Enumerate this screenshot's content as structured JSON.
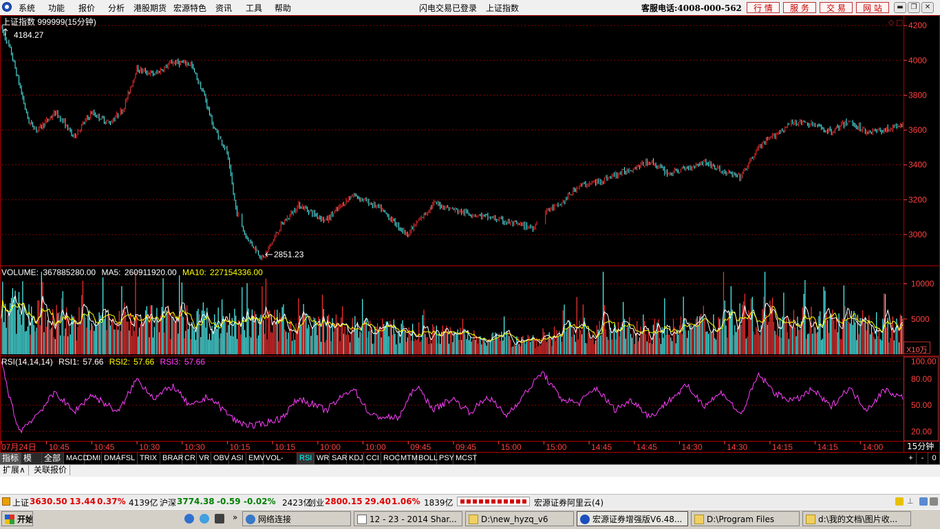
{
  "menu": {
    "items": [
      "系统",
      "功能",
      "报价",
      "分析",
      "港股期货",
      "宏源特色",
      "资讯",
      "工具",
      "帮助"
    ],
    "login_status": "闪电交易已登录",
    "current_index": "上证指数",
    "hotline": "客服电话:4008-000-562",
    "buttons": [
      "行 情",
      "服 务",
      "交 易",
      "网 站"
    ]
  },
  "chart": {
    "title": "上证指数 999999(15分钟)",
    "high_label": "4184.27",
    "low_label": "2851.23",
    "volume_header": {
      "name": "VOLUME:",
      "value": "367885280.00",
      "ma5_label": "MA5:",
      "ma5": "260911920.00",
      "ma10_label": "MA10:",
      "ma10": "227154336.00"
    },
    "volume_unit": "X10万",
    "rsi_header": {
      "name": "RSI(14,14,14)",
      "rsi1_label": "RSI1:",
      "rsi1": "57.66",
      "rsi2_label": "RSI2:",
      "rsi2": "57.66",
      "rsi3_label": "RSI3:",
      "rsi3": "57.66"
    },
    "period_label": "15分钟",
    "colors": {
      "up": "#ff3232",
      "down": "#54ffff",
      "ma5": "#ffffff",
      "ma10": "#ffff00",
      "rsi": "#ff40ff",
      "grid": "#8b0000",
      "axis": "#b00000"
    }
  },
  "chart_data": {
    "type": "candlestick",
    "price_axis": {
      "ticks": [
        3000,
        3200,
        3400,
        3600,
        3800,
        4000,
        4200
      ],
      "ylim": [
        2830,
        4240
      ]
    },
    "volume_axis": {
      "ticks": [
        5000,
        10000
      ],
      "ylim": [
        0,
        12000
      ]
    },
    "rsi_axis": {
      "ticks": [
        "20.00",
        "50.00",
        "80.00",
        "100.00"
      ],
      "ylim": [
        10,
        105
      ]
    },
    "x_ticks": [
      "07月24日",
      "10:45",
      "10:45",
      "10:30",
      "10:30",
      "10:15",
      "10:15",
      "10:00",
      "10:00",
      "09:45",
      "09:45",
      "15:00",
      "15:00",
      "14:45",
      "14:45",
      "14:30",
      "14:30",
      "14:15",
      "14:15",
      "14:00"
    ],
    "price_path": [
      [
        0,
        4184
      ],
      [
        0.01,
        4060
      ],
      [
        0.02,
        3860
      ],
      [
        0.03,
        3650
      ],
      [
        0.04,
        3600
      ],
      [
        0.06,
        3700
      ],
      [
        0.07,
        3640
      ],
      [
        0.08,
        3560
      ],
      [
        0.1,
        3700
      ],
      [
        0.12,
        3640
      ],
      [
        0.135,
        3720
      ],
      [
        0.15,
        3950
      ],
      [
        0.17,
        3920
      ],
      [
        0.19,
        3990
      ],
      [
        0.21,
        3980
      ],
      [
        0.225,
        3800
      ],
      [
        0.235,
        3620
      ],
      [
        0.25,
        3480
      ],
      [
        0.26,
        3150
      ],
      [
        0.27,
        3000
      ],
      [
        0.29,
        2860
      ],
      [
        0.31,
        3050
      ],
      [
        0.33,
        3170
      ],
      [
        0.36,
        3080
      ],
      [
        0.39,
        3230
      ],
      [
        0.42,
        3150
      ],
      [
        0.45,
        3000
      ],
      [
        0.48,
        3180
      ],
      [
        0.51,
        3130
      ],
      [
        0.54,
        3100
      ],
      [
        0.57,
        3060
      ],
      [
        0.59,
        3040
      ],
      [
        0.6,
        3130
      ],
      [
        0.62,
        3170
      ],
      [
        0.64,
        3280
      ],
      [
        0.66,
        3300
      ],
      [
        0.68,
        3340
      ],
      [
        0.7,
        3380
      ],
      [
        0.72,
        3420
      ],
      [
        0.74,
        3350
      ],
      [
        0.76,
        3380
      ],
      [
        0.78,
        3420
      ],
      [
        0.8,
        3360
      ],
      [
        0.82,
        3330
      ],
      [
        0.84,
        3500
      ],
      [
        0.86,
        3580
      ],
      [
        0.88,
        3650
      ],
      [
        0.9,
        3630
      ],
      [
        0.92,
        3590
      ],
      [
        0.94,
        3650
      ],
      [
        0.96,
        3590
      ],
      [
        0.98,
        3600
      ],
      [
        1,
        3630
      ]
    ],
    "rsi_path": [
      [
        0,
        100
      ],
      [
        0.01,
        55
      ],
      [
        0.02,
        20
      ],
      [
        0.04,
        40
      ],
      [
        0.06,
        65
      ],
      [
        0.08,
        42
      ],
      [
        0.1,
        62
      ],
      [
        0.13,
        42
      ],
      [
        0.15,
        80
      ],
      [
        0.17,
        58
      ],
      [
        0.19,
        72
      ],
      [
        0.21,
        48
      ],
      [
        0.23,
        60
      ],
      [
        0.26,
        32
      ],
      [
        0.28,
        26
      ],
      [
        0.31,
        35
      ],
      [
        0.33,
        58
      ],
      [
        0.36,
        44
      ],
      [
        0.39,
        70
      ],
      [
        0.41,
        38
      ],
      [
        0.44,
        35
      ],
      [
        0.46,
        72
      ],
      [
        0.48,
        45
      ],
      [
        0.5,
        58
      ],
      [
        0.52,
        42
      ],
      [
        0.54,
        60
      ],
      [
        0.56,
        38
      ],
      [
        0.58,
        62
      ],
      [
        0.6,
        88
      ],
      [
        0.62,
        58
      ],
      [
        0.64,
        52
      ],
      [
        0.66,
        70
      ],
      [
        0.68,
        45
      ],
      [
        0.7,
        56
      ],
      [
        0.72,
        36
      ],
      [
        0.74,
        55
      ],
      [
        0.76,
        72
      ],
      [
        0.78,
        50
      ],
      [
        0.8,
        65
      ],
      [
        0.82,
        38
      ],
      [
        0.84,
        85
      ],
      [
        0.86,
        62
      ],
      [
        0.88,
        55
      ],
      [
        0.9,
        68
      ],
      [
        0.92,
        48
      ],
      [
        0.94,
        70
      ],
      [
        0.96,
        45
      ],
      [
        0.98,
        68
      ],
      [
        1,
        58
      ]
    ],
    "volume_trend": [
      [
        0,
        8500
      ],
      [
        0.03,
        6500
      ],
      [
        0.08,
        5500
      ],
      [
        0.15,
        6000
      ],
      [
        0.25,
        5500
      ],
      [
        0.35,
        4800
      ],
      [
        0.45,
        3800
      ],
      [
        0.55,
        2800
      ],
      [
        0.6,
        2500
      ],
      [
        0.62,
        3800
      ],
      [
        0.75,
        4200
      ],
      [
        0.85,
        7000
      ],
      [
        0.88,
        6000
      ],
      [
        1,
        4500
      ]
    ],
    "gaps": [
      [
        0.263,
        0.267
      ],
      [
        0.595,
        0.603
      ]
    ]
  },
  "indicators": {
    "items": [
      "指标",
      "模板",
      "全部",
      "MACD",
      "DMI",
      "DMA",
      "FSL",
      "TRIX",
      "BRAR",
      "CR",
      "VR",
      "OBV",
      "ASI",
      "EMV",
      "VOL-TDX",
      "RSI",
      "WR",
      "SAR",
      "KDJ",
      "CCI",
      "ROC",
      "MTM",
      "BOLL",
      "PSY",
      "MCST"
    ],
    "selected": "RSI",
    "zoom_buttons": [
      "+",
      "-",
      "0"
    ]
  },
  "ext_tabs": [
    "扩展∧",
    "关联报价"
  ],
  "status": {
    "sh_label": "上证",
    "sh_val": "3630.50",
    "sh_chg": "13.44",
    "sh_pct": "0.37%",
    "sh_amt": "4139亿",
    "hs_label": "沪深",
    "hs_val": "3774.38",
    "hs_chg": "-0.59",
    "hs_pct": "-0.02%",
    "hs_amt": "2423亿",
    "cy_label": "创业",
    "cy_val": "2800.15",
    "cy_chg": "29.40",
    "cy_pct": "1.06%",
    "cy_amt": "1839亿",
    "server": "宏源证券阿里云(4)"
  },
  "taskbar": {
    "start": "开始",
    "items": [
      "网络连接",
      "12 - 23 - 2014 Shar...",
      "D:\\new_hyzq_v6",
      "宏源证券增强版V6.48...",
      "D:\\Program Files",
      "d:\\我的文档\\图片收..."
    ],
    "active": 3
  }
}
